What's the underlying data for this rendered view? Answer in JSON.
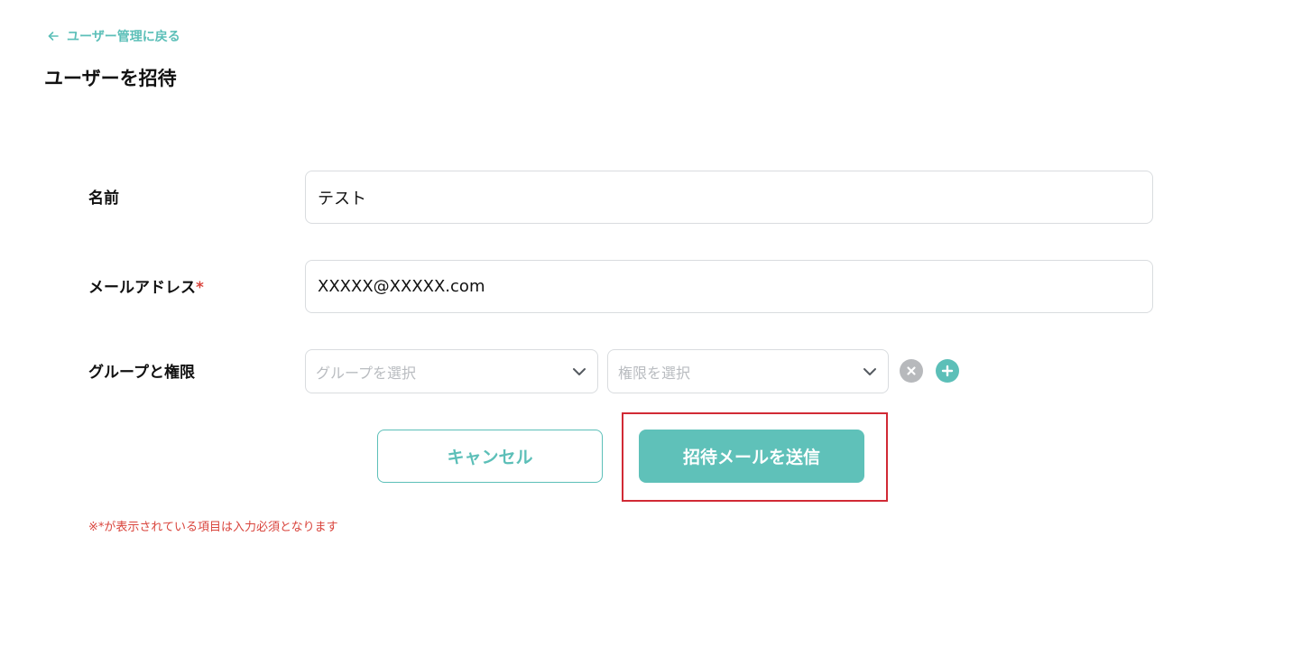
{
  "back_link": {
    "label": "ユーザー管理に戻る",
    "icon": "arrow-left-icon"
  },
  "page": {
    "title": "ユーザーを招待"
  },
  "form": {
    "name": {
      "label": "名前",
      "value": "テスト"
    },
    "email": {
      "label": "メールアドレス",
      "required_mark": "*",
      "value": "XXXXX@XXXXX.com"
    },
    "group_permission": {
      "label": "グループと権限",
      "group_placeholder": "グループを選択",
      "permission_placeholder": "権限を選択",
      "chevron_icon": "chevron-down-icon",
      "remove_icon": "close-circle-icon",
      "add_icon": "plus-circle-icon"
    }
  },
  "actions": {
    "cancel_label": "キャンセル",
    "send_label": "招待メールを送信"
  },
  "note": "※*が表示されている項目は入力必須となります",
  "colors": {
    "accent": "#5cbfb8",
    "required": "#d9443c",
    "highlight": "#d12a35",
    "icon_gray": "#b7b9bc"
  }
}
